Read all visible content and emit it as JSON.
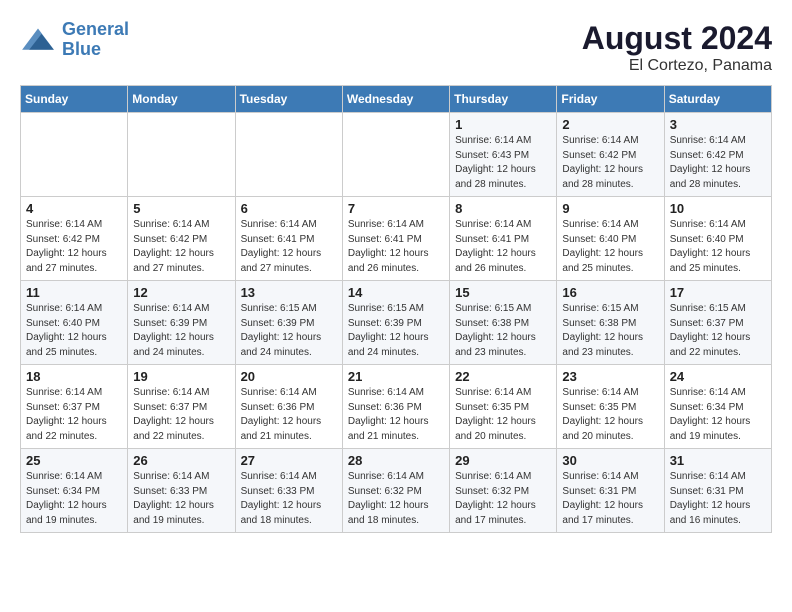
{
  "logo": {
    "line1": "General",
    "line2": "Blue"
  },
  "title": "August 2024",
  "subtitle": "El Cortezo, Panama",
  "days_of_week": [
    "Sunday",
    "Monday",
    "Tuesday",
    "Wednesday",
    "Thursday",
    "Friday",
    "Saturday"
  ],
  "weeks": [
    [
      {
        "day": "",
        "info": ""
      },
      {
        "day": "",
        "info": ""
      },
      {
        "day": "",
        "info": ""
      },
      {
        "day": "",
        "info": ""
      },
      {
        "day": "1",
        "info": "Sunrise: 6:14 AM\nSunset: 6:43 PM\nDaylight: 12 hours\nand 28 minutes."
      },
      {
        "day": "2",
        "info": "Sunrise: 6:14 AM\nSunset: 6:42 PM\nDaylight: 12 hours\nand 28 minutes."
      },
      {
        "day": "3",
        "info": "Sunrise: 6:14 AM\nSunset: 6:42 PM\nDaylight: 12 hours\nand 28 minutes."
      }
    ],
    [
      {
        "day": "4",
        "info": "Sunrise: 6:14 AM\nSunset: 6:42 PM\nDaylight: 12 hours\nand 27 minutes."
      },
      {
        "day": "5",
        "info": "Sunrise: 6:14 AM\nSunset: 6:42 PM\nDaylight: 12 hours\nand 27 minutes."
      },
      {
        "day": "6",
        "info": "Sunrise: 6:14 AM\nSunset: 6:41 PM\nDaylight: 12 hours\nand 27 minutes."
      },
      {
        "day": "7",
        "info": "Sunrise: 6:14 AM\nSunset: 6:41 PM\nDaylight: 12 hours\nand 26 minutes."
      },
      {
        "day": "8",
        "info": "Sunrise: 6:14 AM\nSunset: 6:41 PM\nDaylight: 12 hours\nand 26 minutes."
      },
      {
        "day": "9",
        "info": "Sunrise: 6:14 AM\nSunset: 6:40 PM\nDaylight: 12 hours\nand 25 minutes."
      },
      {
        "day": "10",
        "info": "Sunrise: 6:14 AM\nSunset: 6:40 PM\nDaylight: 12 hours\nand 25 minutes."
      }
    ],
    [
      {
        "day": "11",
        "info": "Sunrise: 6:14 AM\nSunset: 6:40 PM\nDaylight: 12 hours\nand 25 minutes."
      },
      {
        "day": "12",
        "info": "Sunrise: 6:14 AM\nSunset: 6:39 PM\nDaylight: 12 hours\nand 24 minutes."
      },
      {
        "day": "13",
        "info": "Sunrise: 6:15 AM\nSunset: 6:39 PM\nDaylight: 12 hours\nand 24 minutes."
      },
      {
        "day": "14",
        "info": "Sunrise: 6:15 AM\nSunset: 6:39 PM\nDaylight: 12 hours\nand 24 minutes."
      },
      {
        "day": "15",
        "info": "Sunrise: 6:15 AM\nSunset: 6:38 PM\nDaylight: 12 hours\nand 23 minutes."
      },
      {
        "day": "16",
        "info": "Sunrise: 6:15 AM\nSunset: 6:38 PM\nDaylight: 12 hours\nand 23 minutes."
      },
      {
        "day": "17",
        "info": "Sunrise: 6:15 AM\nSunset: 6:37 PM\nDaylight: 12 hours\nand 22 minutes."
      }
    ],
    [
      {
        "day": "18",
        "info": "Sunrise: 6:14 AM\nSunset: 6:37 PM\nDaylight: 12 hours\nand 22 minutes."
      },
      {
        "day": "19",
        "info": "Sunrise: 6:14 AM\nSunset: 6:37 PM\nDaylight: 12 hours\nand 22 minutes."
      },
      {
        "day": "20",
        "info": "Sunrise: 6:14 AM\nSunset: 6:36 PM\nDaylight: 12 hours\nand 21 minutes."
      },
      {
        "day": "21",
        "info": "Sunrise: 6:14 AM\nSunset: 6:36 PM\nDaylight: 12 hours\nand 21 minutes."
      },
      {
        "day": "22",
        "info": "Sunrise: 6:14 AM\nSunset: 6:35 PM\nDaylight: 12 hours\nand 20 minutes."
      },
      {
        "day": "23",
        "info": "Sunrise: 6:14 AM\nSunset: 6:35 PM\nDaylight: 12 hours\nand 20 minutes."
      },
      {
        "day": "24",
        "info": "Sunrise: 6:14 AM\nSunset: 6:34 PM\nDaylight: 12 hours\nand 19 minutes."
      }
    ],
    [
      {
        "day": "25",
        "info": "Sunrise: 6:14 AM\nSunset: 6:34 PM\nDaylight: 12 hours\nand 19 minutes."
      },
      {
        "day": "26",
        "info": "Sunrise: 6:14 AM\nSunset: 6:33 PM\nDaylight: 12 hours\nand 19 minutes."
      },
      {
        "day": "27",
        "info": "Sunrise: 6:14 AM\nSunset: 6:33 PM\nDaylight: 12 hours\nand 18 minutes."
      },
      {
        "day": "28",
        "info": "Sunrise: 6:14 AM\nSunset: 6:32 PM\nDaylight: 12 hours\nand 18 minutes."
      },
      {
        "day": "29",
        "info": "Sunrise: 6:14 AM\nSunset: 6:32 PM\nDaylight: 12 hours\nand 17 minutes."
      },
      {
        "day": "30",
        "info": "Sunrise: 6:14 AM\nSunset: 6:31 PM\nDaylight: 12 hours\nand 17 minutes."
      },
      {
        "day": "31",
        "info": "Sunrise: 6:14 AM\nSunset: 6:31 PM\nDaylight: 12 hours\nand 16 minutes."
      }
    ]
  ]
}
